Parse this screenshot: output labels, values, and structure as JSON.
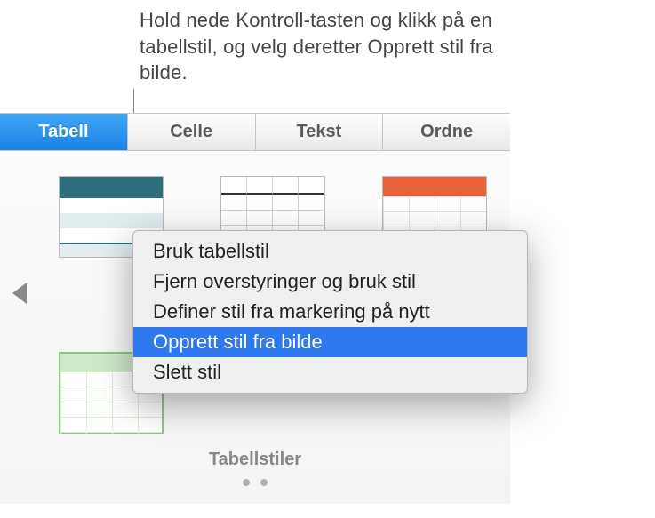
{
  "callout": {
    "text": "Hold nede Kontroll-tasten og klikk på en tabellstil, og velg deretter Opprett stil fra bilde."
  },
  "tabs": {
    "items": [
      {
        "label": "Tabell",
        "active": true
      },
      {
        "label": "Celle",
        "active": false
      },
      {
        "label": "Tekst",
        "active": false
      },
      {
        "label": "Ordne",
        "active": false
      }
    ]
  },
  "styles_section": {
    "title": "Tabellstiler",
    "thumbnail_names": [
      "teal-header",
      "outline-grid",
      "orange-header",
      "green-grid"
    ]
  },
  "context_menu": {
    "items": [
      {
        "label": "Bruk tabellstil",
        "highlight": false
      },
      {
        "label": "Fjern overstyringer og bruk stil",
        "highlight": false
      },
      {
        "label": "Definer stil fra markering på nytt",
        "highlight": false
      },
      {
        "label": "Opprett stil fra bilde",
        "highlight": true
      },
      {
        "label": "Slett stil",
        "highlight": false
      }
    ]
  }
}
